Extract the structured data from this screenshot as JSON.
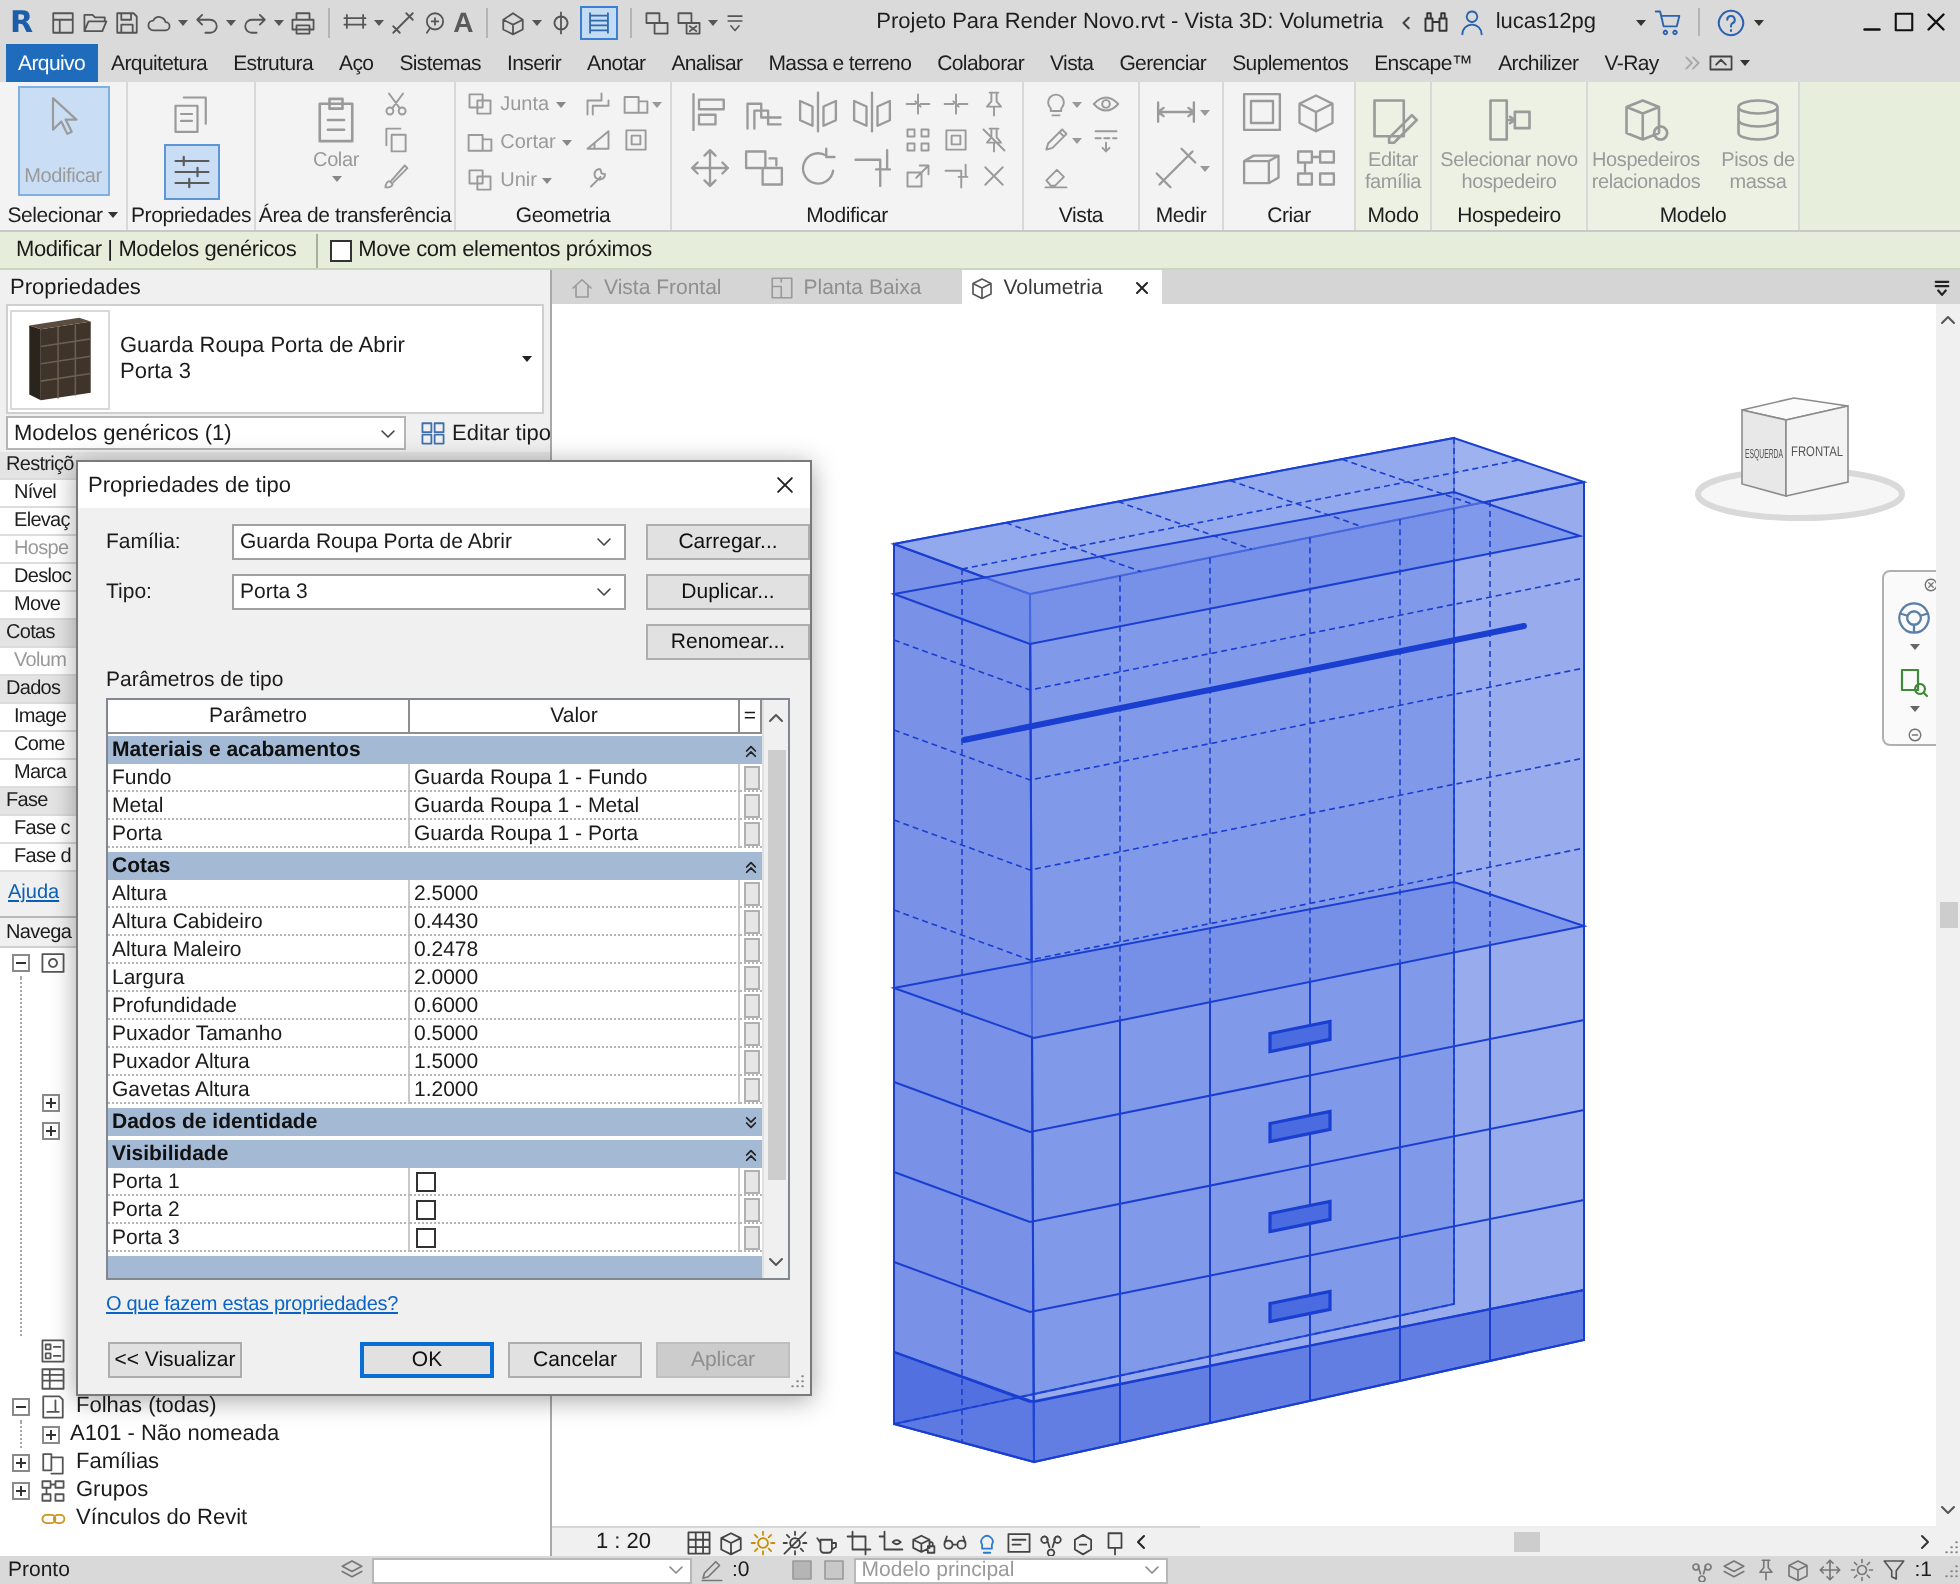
{
  "title_bar": {
    "app_logo": "R",
    "text_tool": "A",
    "thin_lines_selected": true,
    "title": "Projeto Para Render Novo.rvt - Vista 3D: Volumetria",
    "user": "lucas12pg"
  },
  "ribbon": {
    "tabs": [
      {
        "label": "Arquivo",
        "selected": true
      },
      {
        "label": "Arquitetura",
        "selected": false
      },
      {
        "label": "Estrutura",
        "selected": false
      },
      {
        "label": "Aço",
        "selected": false
      },
      {
        "label": "Sistemas",
        "selected": false
      },
      {
        "label": "Inserir",
        "selected": false
      },
      {
        "label": "Anotar",
        "selected": false
      },
      {
        "label": "Analisar",
        "selected": false
      },
      {
        "label": "Massa e terreno",
        "selected": false
      },
      {
        "label": "Colaborar",
        "selected": false
      },
      {
        "label": "Vista",
        "selected": false
      },
      {
        "label": "Gerenciar",
        "selected": false
      },
      {
        "label": "Suplementos",
        "selected": false
      },
      {
        "label": "Enscape™",
        "selected": false
      },
      {
        "label": "Archilizer",
        "selected": false
      },
      {
        "label": "V-Ray",
        "selected": false
      }
    ],
    "panels": [
      {
        "label": "Selecionar",
        "dropdown": true,
        "buttons": [
          {
            "kind": "large",
            "label": "Modificar",
            "selected": true,
            "disabled": true
          }
        ]
      },
      {
        "label": "Propriedades",
        "buttons": [
          {
            "kind": "icon",
            "selected": false
          },
          {
            "kind": "icon",
            "selected": true
          }
        ]
      },
      {
        "label": "Área de transferência",
        "buttons": [
          {
            "kind": "large",
            "label": "Colar",
            "selected": false,
            "disabled": true,
            "dropdown": true
          }
        ]
      },
      {
        "label": "Geometria",
        "buttons": [
          {
            "kind": "small",
            "label": "Junta",
            "disabled": true,
            "dropdown": true
          },
          {
            "kind": "small",
            "label": "Cortar",
            "disabled": true,
            "dropdown": true
          },
          {
            "kind": "small",
            "label": "Unir",
            "disabled": true,
            "dropdown": true
          }
        ]
      },
      {
        "label": "Modificar"
      },
      {
        "label": "Vista"
      },
      {
        "label": "Medir"
      },
      {
        "label": "Criar"
      },
      {
        "label": "Modo",
        "contextual": true,
        "buttons": [
          {
            "kind": "large",
            "label": "Editar família",
            "selected": false,
            "disabled": true
          }
        ]
      },
      {
        "label": "Hospedeiro",
        "contextual": true,
        "buttons": [
          {
            "kind": "large",
            "label": "Selecionar novo hospedeiro",
            "selected": false,
            "disabled": true
          }
        ]
      },
      {
        "label": "Modelo",
        "contextual": true,
        "buttons": [
          {
            "kind": "large",
            "label": "Hospedeiros relacionados",
            "selected": false,
            "disabled": true
          },
          {
            "kind": "large",
            "label": "Pisos de massa",
            "selected": false,
            "disabled": true
          }
        ]
      }
    ]
  },
  "options_bar": {
    "context": "Modificar | Modelos genéricos",
    "option": {
      "label": "Move com elementos próximos",
      "checked": false
    }
  },
  "properties": {
    "title": "Propriedades",
    "family": "Guarda Roupa Porta de Abrir",
    "type": "Porta 3",
    "category": "Modelos genéricos (1)",
    "edit_type": "Editar tipo",
    "groups": [
      {
        "label": "Restriçõ",
        "rows": [
          {
            "label": "Nível",
            "disabled": false
          },
          {
            "label": "Elevaç",
            "disabled": false
          },
          {
            "label": "Hospe",
            "disabled": true
          },
          {
            "label": "Desloc",
            "disabled": false
          },
          {
            "label": "Move",
            "disabled": false
          }
        ]
      },
      {
        "label": "Cotas",
        "rows": [
          {
            "label": "Volum",
            "disabled": true
          }
        ]
      },
      {
        "label": "Dados",
        "rows": [
          {
            "label": "Image",
            "disabled": false
          },
          {
            "label": "Come",
            "disabled": false
          },
          {
            "label": "Marca",
            "disabled": false
          }
        ]
      },
      {
        "label": "Fase",
        "rows": [
          {
            "label": "Fase c",
            "disabled": false
          },
          {
            "label": "Fase d",
            "disabled": false
          }
        ]
      }
    ],
    "help_link": "Ajuda"
  },
  "project_browser": {
    "title": "Navega",
    "tree": [
      {
        "kind": "views",
        "expanded": true,
        "children": [
          {
            "expanded": false
          },
          {
            "expanded": false
          }
        ]
      },
      {
        "kind": "legends"
      },
      {
        "kind": "schedules"
      },
      {
        "kind": "sheets",
        "label": "Folhas (todas)",
        "expanded": true,
        "children": [
          {
            "label": "A101 - Não nomeada",
            "expanded": false
          }
        ]
      },
      {
        "kind": "families",
        "label": "Famílias",
        "expanded": false
      },
      {
        "kind": "groups",
        "label": "Grupos",
        "expanded": false
      },
      {
        "kind": "links",
        "label": "Vínculos do Revit"
      }
    ]
  },
  "view_tabs": [
    {
      "label": "Vista Frontal",
      "kind": "elevation",
      "selected": false
    },
    {
      "label": "Planta Baixa",
      "kind": "plan",
      "selected": false
    },
    {
      "label": "Volumetria",
      "kind": "perspective",
      "selected": true
    }
  ],
  "view_cube": {
    "left_face": "ESQUERDA",
    "front_face": "FRONTAL"
  },
  "view_control_bar": {
    "scale": "1 : 20"
  },
  "status_bar": {
    "text": "Pronto",
    "editable_count": ":0",
    "model": "Modelo principal",
    "filter_count": ":1"
  },
  "dialog": {
    "title": "Propriedades de tipo",
    "family": {
      "label": "Família:",
      "value": "Guarda Roupa Porta de Abrir"
    },
    "type": {
      "label": "Tipo:",
      "value": "Porta 3"
    },
    "side_buttons": [
      "Carregar...",
      "Duplicar...",
      "Renomear..."
    ],
    "section": "Parâmetros de tipo",
    "columns": [
      "Parâmetro",
      "Valor",
      "="
    ],
    "groups": [
      {
        "label": "Materiais e acabamentos",
        "expanded": true,
        "rows": [
          {
            "name": "Fundo",
            "kind": "value",
            "value": "Guarda Roupa 1 - Fundo"
          },
          {
            "name": "Metal",
            "kind": "value",
            "value": "Guarda Roupa 1 - Metal"
          },
          {
            "name": "Porta",
            "kind": "value",
            "value": "Guarda Roupa 1 - Porta"
          }
        ]
      },
      {
        "label": "Cotas",
        "expanded": true,
        "rows": [
          {
            "name": "Altura",
            "kind": "value",
            "value": "2.5000"
          },
          {
            "name": "Altura Cabideiro",
            "kind": "value",
            "value": "0.4430"
          },
          {
            "name": "Altura Maleiro",
            "kind": "value",
            "value": "0.2478"
          },
          {
            "name": "Largura",
            "kind": "value",
            "value": "2.0000"
          },
          {
            "name": "Profundidade",
            "kind": "value",
            "value": "0.6000"
          },
          {
            "name": "Puxador Tamanho",
            "kind": "value",
            "value": "0.5000"
          },
          {
            "name": "Puxador Altura",
            "kind": "value",
            "value": "1.5000"
          },
          {
            "name": "Gavetas Altura",
            "kind": "value",
            "value": "1.2000"
          }
        ]
      },
      {
        "label": "Dados de identidade",
        "expanded": false
      },
      {
        "label": "Visibilidade",
        "expanded": true,
        "rows": [
          {
            "name": "Porta 1",
            "kind": "checkbox",
            "checked": false
          },
          {
            "name": "Porta 2",
            "kind": "checkbox",
            "checked": false
          },
          {
            "name": "Porta 3",
            "kind": "checkbox",
            "checked": false
          }
        ]
      }
    ],
    "help_link": "O que fazem estas propriedades?",
    "buttons": [
      {
        "label": "<< Visualizar",
        "default": false,
        "disabled": false
      },
      {
        "label": "OK",
        "default": true,
        "disabled": false
      },
      {
        "label": "Cancelar",
        "default": false,
        "disabled": false
      },
      {
        "label": "Aplicar",
        "default": false,
        "disabled": true
      }
    ]
  }
}
